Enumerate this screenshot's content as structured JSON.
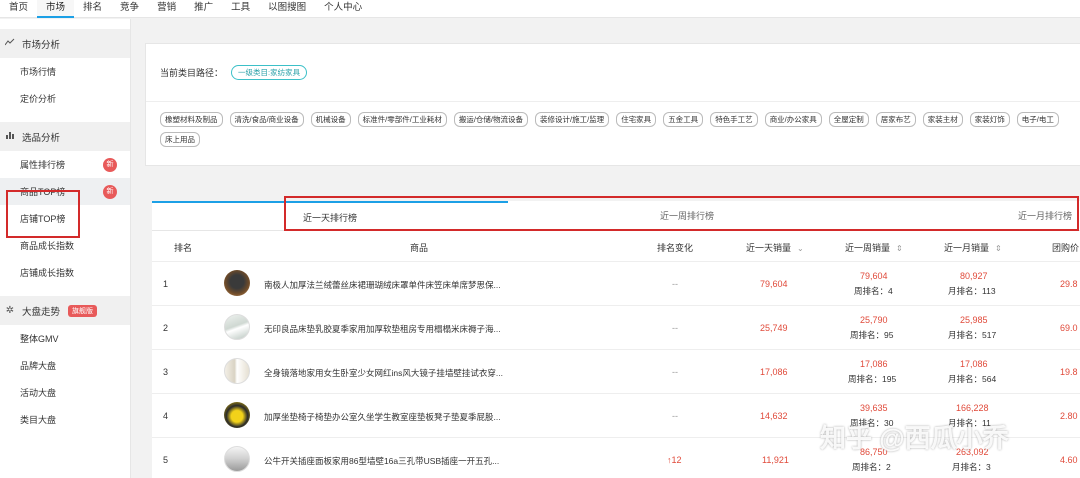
{
  "topnav": [
    "首页",
    "市场",
    "排名",
    "竞争",
    "营销",
    "推广",
    "工具",
    "以图搜图",
    "个人中心"
  ],
  "sidebar": {
    "groups": [
      {
        "icon": "trend-icon",
        "label": "市场分析",
        "items": [
          {
            "label": "市场行情"
          },
          {
            "label": "定价分析"
          }
        ]
      },
      {
        "icon": "bar-chart-icon",
        "label": "选品分析",
        "items": [
          {
            "label": "属性排行榜",
            "badge": "新"
          },
          {
            "label": "商品TOP榜",
            "badge": "新"
          },
          {
            "label": "店铺TOP榜"
          },
          {
            "label": "商品成长指数"
          },
          {
            "label": "店铺成长指数"
          }
        ]
      },
      {
        "icon": "pinwheel-icon",
        "label": "大盘走势",
        "flag": "旗舰版",
        "items": [
          {
            "label": "整体GMV"
          },
          {
            "label": "品牌大盘"
          },
          {
            "label": "活动大盘"
          },
          {
            "label": "类目大盘"
          }
        ]
      }
    ]
  },
  "category": {
    "path_label": "当前类目路径：",
    "path_value": "一级类目:家纺家具",
    "chips": [
      "橡塑材料及制品",
      "清洗/食品/商业设备",
      "机械设备",
      "标准件/零部件/工业耗材",
      "搬运/仓储/物流设备",
      "装修设计/施工/监理",
      "住宅家具",
      "五金工具",
      "特色手工艺",
      "商业/办公家具",
      "全屋定制",
      "居家布艺",
      "家装主材",
      "家装灯饰",
      "电子/电工",
      "床上用品"
    ]
  },
  "tabs": [
    "近一天排行榜",
    "近一周排行榜",
    "近一月排行榜"
  ],
  "table": {
    "headers": {
      "rank": "排名",
      "product": "商品",
      "change": "排名变化",
      "day": "近一天销量",
      "week": "近一周销量",
      "month": "近一月销量",
      "group": "团购价"
    },
    "rows": [
      {
        "rank": "1",
        "name": "南极人加厚法兰绒蕾丝床裙珊瑚绒床罩单件床笠床单席梦思保...",
        "change": "--",
        "day": "79,604",
        "week": "79,604",
        "week_rank": "周排名：4",
        "month": "80,927",
        "month_rank": "月排名：113",
        "group": "29.8"
      },
      {
        "rank": "2",
        "name": "无印良品床垫乳胶夏季家用加厚软垫租房专用榻榻米床褥子海...",
        "change": "--",
        "day": "25,749",
        "week": "25,790",
        "week_rank": "周排名：95",
        "month": "25,985",
        "month_rank": "月排名：517",
        "group": "69.0"
      },
      {
        "rank": "3",
        "name": "全身镜落地家用女生卧室少女网红ins风大镜子挂墙壁挂试衣穿...",
        "change": "--",
        "day": "17,086",
        "week": "17,086",
        "week_rank": "周排名：195",
        "month": "17,086",
        "month_rank": "月排名：564",
        "group": "19.8"
      },
      {
        "rank": "4",
        "name": "加厚坐垫椅子椅垫办公室久坐学生教室座垫板凳子垫夏季屁股...",
        "change": "--",
        "day": "14,632",
        "week": "39,635",
        "week_rank": "周排名：30",
        "month": "166,228",
        "month_rank": "月排名：11",
        "group": "2.80"
      },
      {
        "rank": "5",
        "name": "公牛开关插座面板家用86型墙壁16a三孔带USB插座一开五孔...",
        "change": "12",
        "day": "11,921",
        "week": "86,750",
        "week_rank": "周排名：2",
        "month": "263,092",
        "month_rank": "月排名：3",
        "group": "4.60"
      }
    ]
  },
  "watermark": "知乎 @西瓜小乔",
  "colors": {
    "accent": "#1ca0e6",
    "highlight_box": "#d32a2a",
    "value_red": "#e04a3a",
    "badge": "#e85a5a"
  }
}
